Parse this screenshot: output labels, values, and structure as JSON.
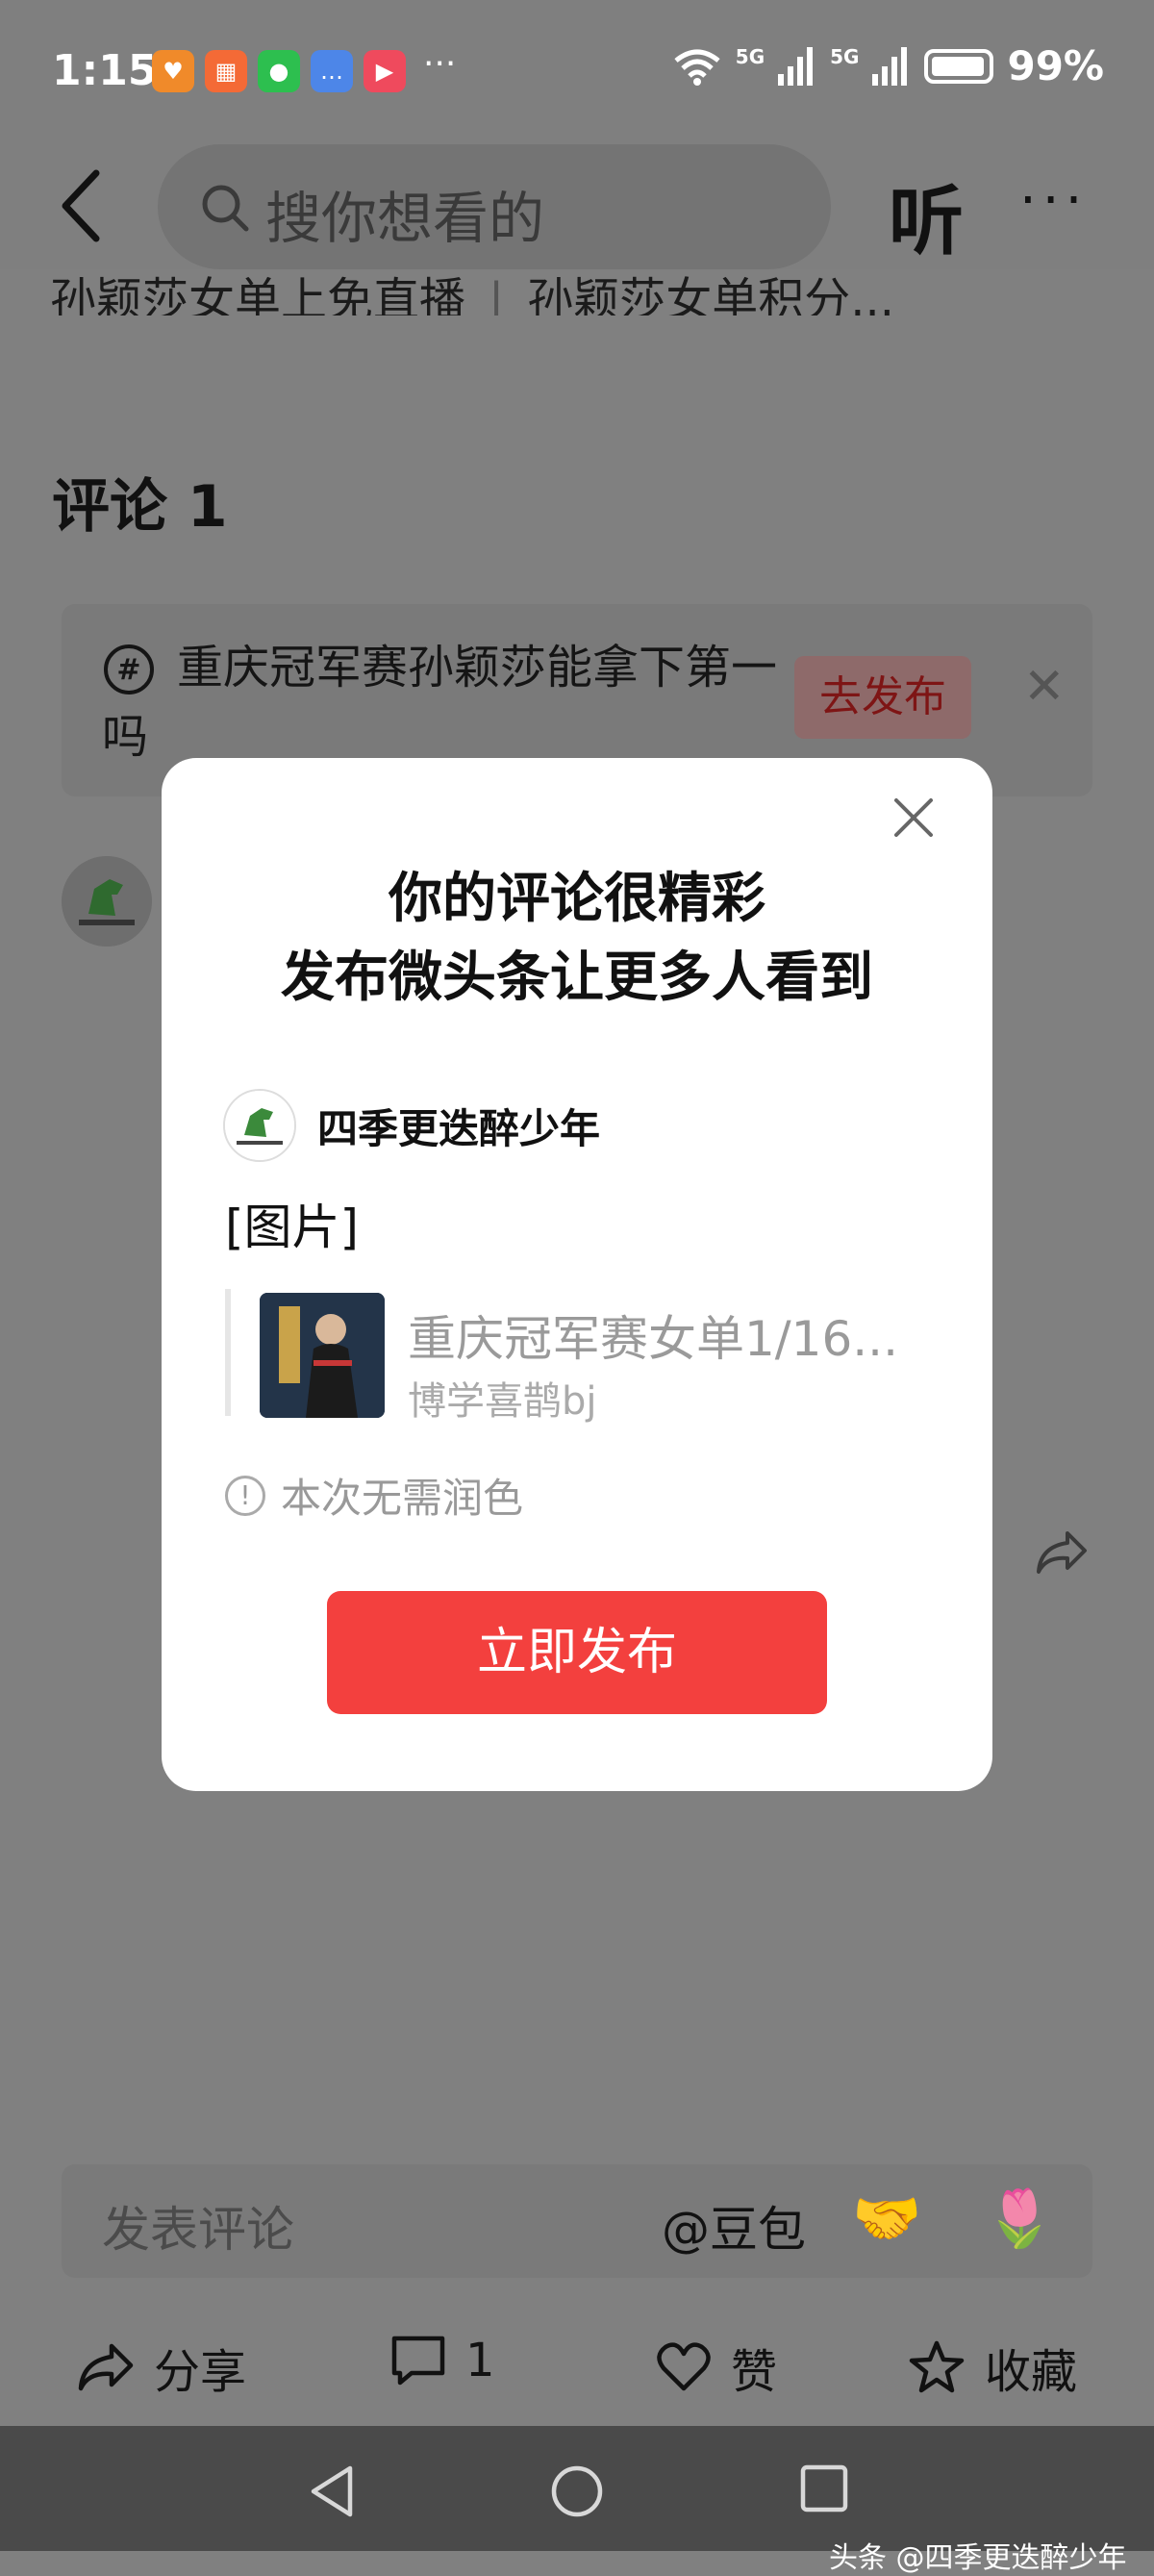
{
  "status": {
    "time": "1:15",
    "app_icons": [
      {
        "name": "heart-app-icon",
        "color": "#f08a2a",
        "glyph": "♥"
      },
      {
        "name": "grid-app-icon",
        "color": "#f46a36",
        "glyph": "▦"
      },
      {
        "name": "wechat-icon",
        "color": "#2dbf4f",
        "glyph": "●"
      },
      {
        "name": "chat-app-icon",
        "color": "#4d86e8",
        "glyph": "…"
      },
      {
        "name": "video-app-icon",
        "color": "#ef4a5d",
        "glyph": "▶"
      }
    ],
    "more": "···",
    "network1": "5G",
    "network2": "5G",
    "battery": "99%"
  },
  "topbar": {
    "search_placeholder": "搜你想看的",
    "listen": "听",
    "menu": "···"
  },
  "hot": {
    "item1": "孙颖莎女单上免直播",
    "item2": "孙颖莎女单积分..."
  },
  "comments": {
    "title": "评论 1"
  },
  "topic": {
    "text": "重庆冠军赛孙颖莎能拿下第一吗",
    "button": "去发布"
  },
  "modal": {
    "title_line1": "你的评论很精彩",
    "title_line2": "发布微头条让更多人看到",
    "username": "四季更迭醉少年",
    "image_label": "[图片]",
    "quote_title": "重庆冠军赛女单1/16...",
    "quote_author": "博学喜鹊bj",
    "notice": "本次无需润色",
    "publish": "立即发布"
  },
  "comment_bar": {
    "placeholder": "发表评论",
    "at": "@豆包",
    "emoji1": "🤝",
    "emoji2": "🌷"
  },
  "actions": {
    "share": "分享",
    "comments_count": "1",
    "like": "赞",
    "favorite": "收藏"
  },
  "watermark": "头条 @四季更迭醉少年"
}
